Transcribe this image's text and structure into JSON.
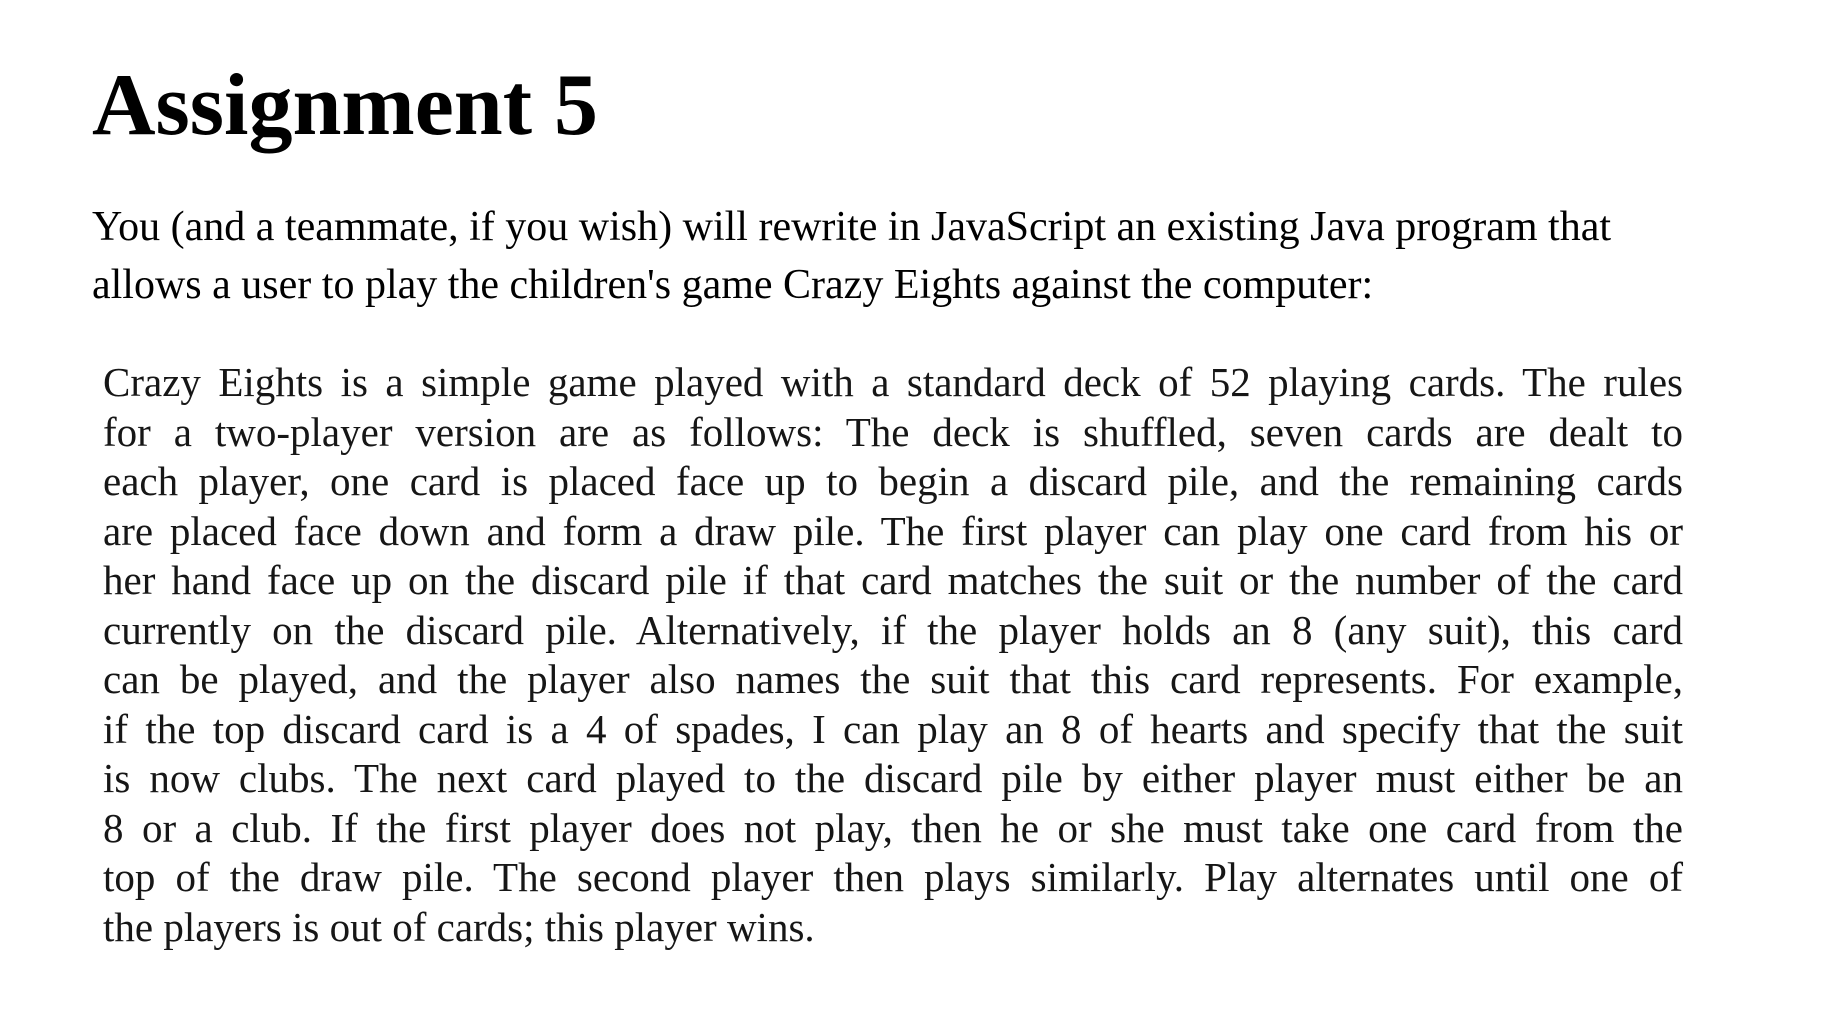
{
  "document": {
    "title": "Assignment 5",
    "intro_lines": [
      "You (and a teammate, if you wish) will rewrite in JavaScript an existing Java program that",
      "allows a user to play the children's game Crazy Eights against the computer:"
    ],
    "quote_lines": [
      "Crazy Eights is a simple game played with a standard deck of 52 playing cards. The rules",
      "for a two-player version are as follows: The deck is shuffled, seven cards are dealt to",
      "each player, one card is placed face up to begin a discard pile, and the remaining cards",
      "are placed face down and form a draw pile. The first player can play one card from his or",
      "her hand face up on the discard pile if that card matches the suit or the number of the card",
      "currently on the discard pile. Alternatively, if the player holds an 8 (any suit), this card",
      "can be played, and the player also names the suit that this card represents. For example,",
      "if the top discard card is a 4 of spades, I can play an 8 of hearts and specify that the suit",
      "is now clubs. The next card played to the discard pile by either player must either be an",
      "8 or a club. If the first player does not play, then he or she must take one card from the",
      "top of the draw pile. The second player then plays similarly. Play alternates until one of",
      "the players is out of cards; this player wins."
    ]
  }
}
